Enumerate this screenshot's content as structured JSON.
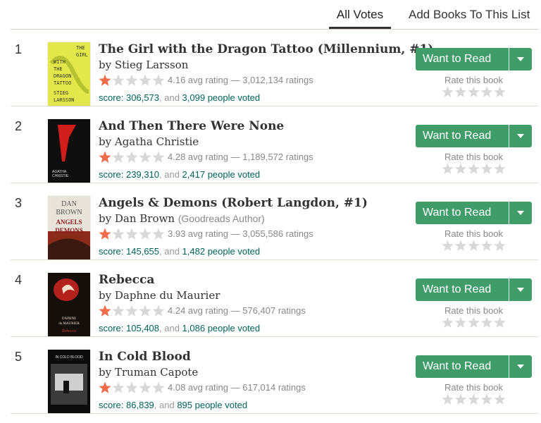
{
  "tabs": {
    "all_votes": "All Votes",
    "add_books": "Add Books To This List"
  },
  "colors": {
    "star": "#f26b4a",
    "star_empty": "#d8d8d8",
    "button": "#409d69",
    "link": "#00635d"
  },
  "wtr_label": "Want to Read",
  "rate_label": "Rate this book",
  "score_prefix": "score: ",
  "score_and": ", and ",
  "books": [
    {
      "rank": "1",
      "title": "The Girl with the Dragon Tattoo (Millennium, #1)",
      "by": "by ",
      "author": "Stieg Larsson",
      "author_role": "",
      "stars": 4.16,
      "minirating": "4.16 avg rating — 3,012,134 ratings",
      "score": "score: 306,573",
      "voters": "3,099 people voted"
    },
    {
      "rank": "2",
      "title": "And Then There Were None",
      "by": "by ",
      "author": "Agatha Christie",
      "author_role": "",
      "stars": 4.28,
      "minirating": "4.28 avg rating — 1,189,572 ratings",
      "score": "score: 239,310",
      "voters": "2,417 people voted"
    },
    {
      "rank": "3",
      "title": "Angels & Demons (Robert Langdon, #1)",
      "by": "by ",
      "author": "Dan Brown",
      "author_role": "(Goodreads Author)",
      "stars": 3.93,
      "minirating": "3.93 avg rating — 3,055,586 ratings",
      "score": "score: 145,655",
      "voters": "1,482 people voted"
    },
    {
      "rank": "4",
      "title": "Rebecca",
      "by": "by ",
      "author": "Daphne du Maurier",
      "author_role": "",
      "stars": 4.24,
      "minirating": "4.24 avg rating — 576,407 ratings",
      "score": "score: 105,408",
      "voters": "1,086 people voted"
    },
    {
      "rank": "5",
      "title": "In Cold Blood",
      "by": "by ",
      "author": "Truman Capote",
      "author_role": "",
      "stars": 4.08,
      "minirating": "4.08 avg rating — 617,014 ratings",
      "score": "score: 86,839",
      "voters": "895 people voted"
    }
  ],
  "covers": [
    {
      "icon": "dragon-tattoo-cover",
      "text_lines": [
        "THE",
        "GIRL",
        "WITH",
        "THE",
        "DRAGON",
        "TATTOO",
        "STIEG",
        "LARSSON"
      ]
    },
    {
      "icon": "and-then-there-were-none-cover",
      "text_lines": [
        "AGATHA",
        "CHRISTIE"
      ]
    },
    {
      "icon": "angels-demons-cover",
      "text_lines": [
        "DAN",
        "BROWN",
        "ANGELS",
        "DEMONS"
      ]
    },
    {
      "icon": "rebecca-cover",
      "text_lines": [
        "DAPHNE",
        "du MAURIER",
        "Rebecca"
      ]
    },
    {
      "icon": "in-cold-blood-cover",
      "text_lines": [
        "IN COLD BLOOD"
      ]
    }
  ]
}
